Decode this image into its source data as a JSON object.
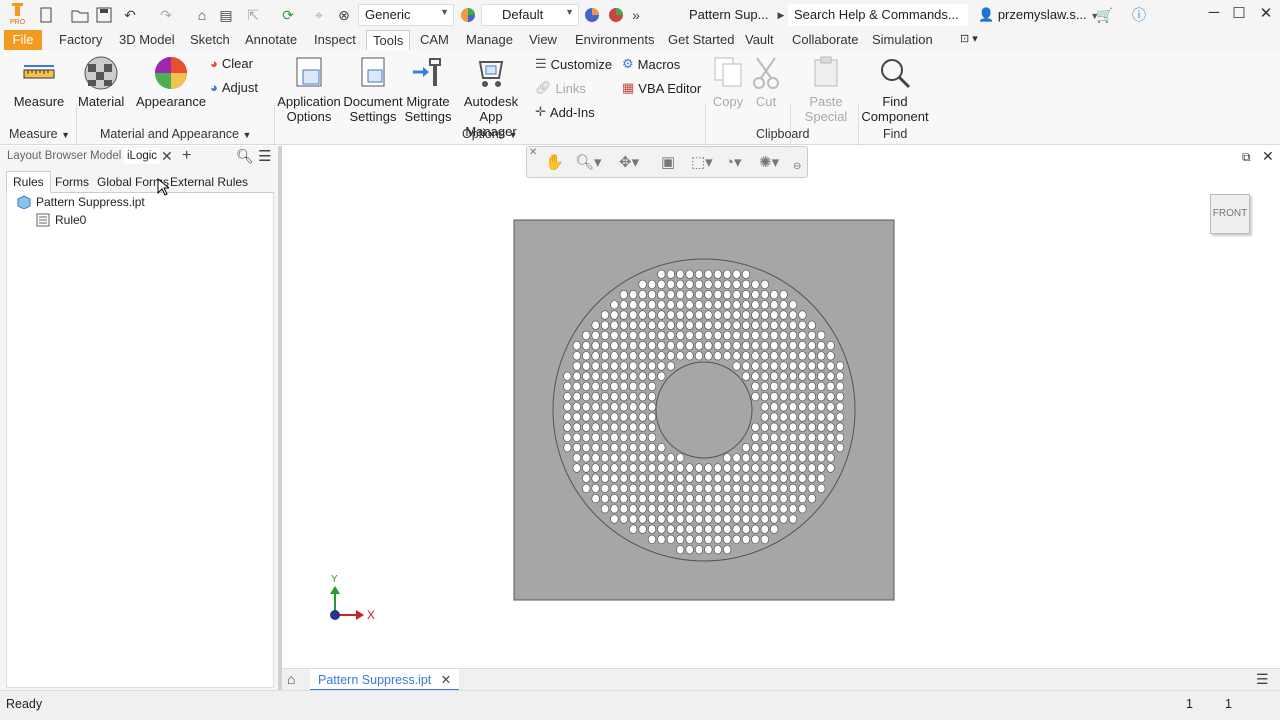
{
  "titlebar": {
    "material_dropdown": "Generic",
    "appearance_dropdown": "Default",
    "window_title": "Pattern Sup...",
    "help_search_placeholder": "Search Help & Commands...",
    "user_name": "przemyslaw.s..."
  },
  "menu": {
    "items": [
      "File",
      "Factory",
      "3D Model",
      "Sketch",
      "Annotate",
      "Inspect",
      "Tools",
      "CAM",
      "Manage",
      "View",
      "Environments",
      "Get Started",
      "Vault",
      "Collaborate",
      "Simulation"
    ],
    "active": "Tools"
  },
  "ribbon": {
    "measure": "Measure",
    "material": "Material",
    "appearance": "Appearance",
    "clear": "Clear",
    "adjust": "Adjust",
    "application_options_1": "Application",
    "application_options_2": "Options",
    "document_settings_1": "Document",
    "document_settings_2": "Settings",
    "migrate_settings_1": "Migrate",
    "migrate_settings_2": "Settings",
    "app_manager_1": "Autodesk",
    "app_manager_2": "App Manager",
    "customize": "Customize",
    "links": "Links",
    "add_ins": "Add-Ins",
    "macros": "Macros",
    "vba_editor": "VBA Editor",
    "copy": "Copy",
    "cut": "Cut",
    "paste_special_1": "Paste",
    "paste_special_2": "Special",
    "find_component_1": "Find",
    "find_component_2": "Component",
    "panels": {
      "measure": "Measure",
      "material_appearance": "Material and Appearance",
      "options": "Options",
      "clipboard": "Clipboard",
      "find": "Find"
    }
  },
  "browser": {
    "tabs": [
      "Layout Browser",
      "Model",
      "iLogic"
    ],
    "active_tab": "iLogic",
    "rule_tabs": [
      "Rules",
      "Forms",
      "Global Forms",
      "External Rules"
    ],
    "active_rule_tab": "Rules",
    "tree": {
      "document": "Pattern Suppress.ipt",
      "rule": "Rule0"
    }
  },
  "viewport": {
    "viewcube_label": "FRONT",
    "axis_x": "X",
    "axis_y": "Y"
  },
  "doc_tab": {
    "label": "Pattern Suppress.ipt"
  },
  "status": {
    "text": "Ready",
    "count1": "1",
    "count2": "1"
  }
}
